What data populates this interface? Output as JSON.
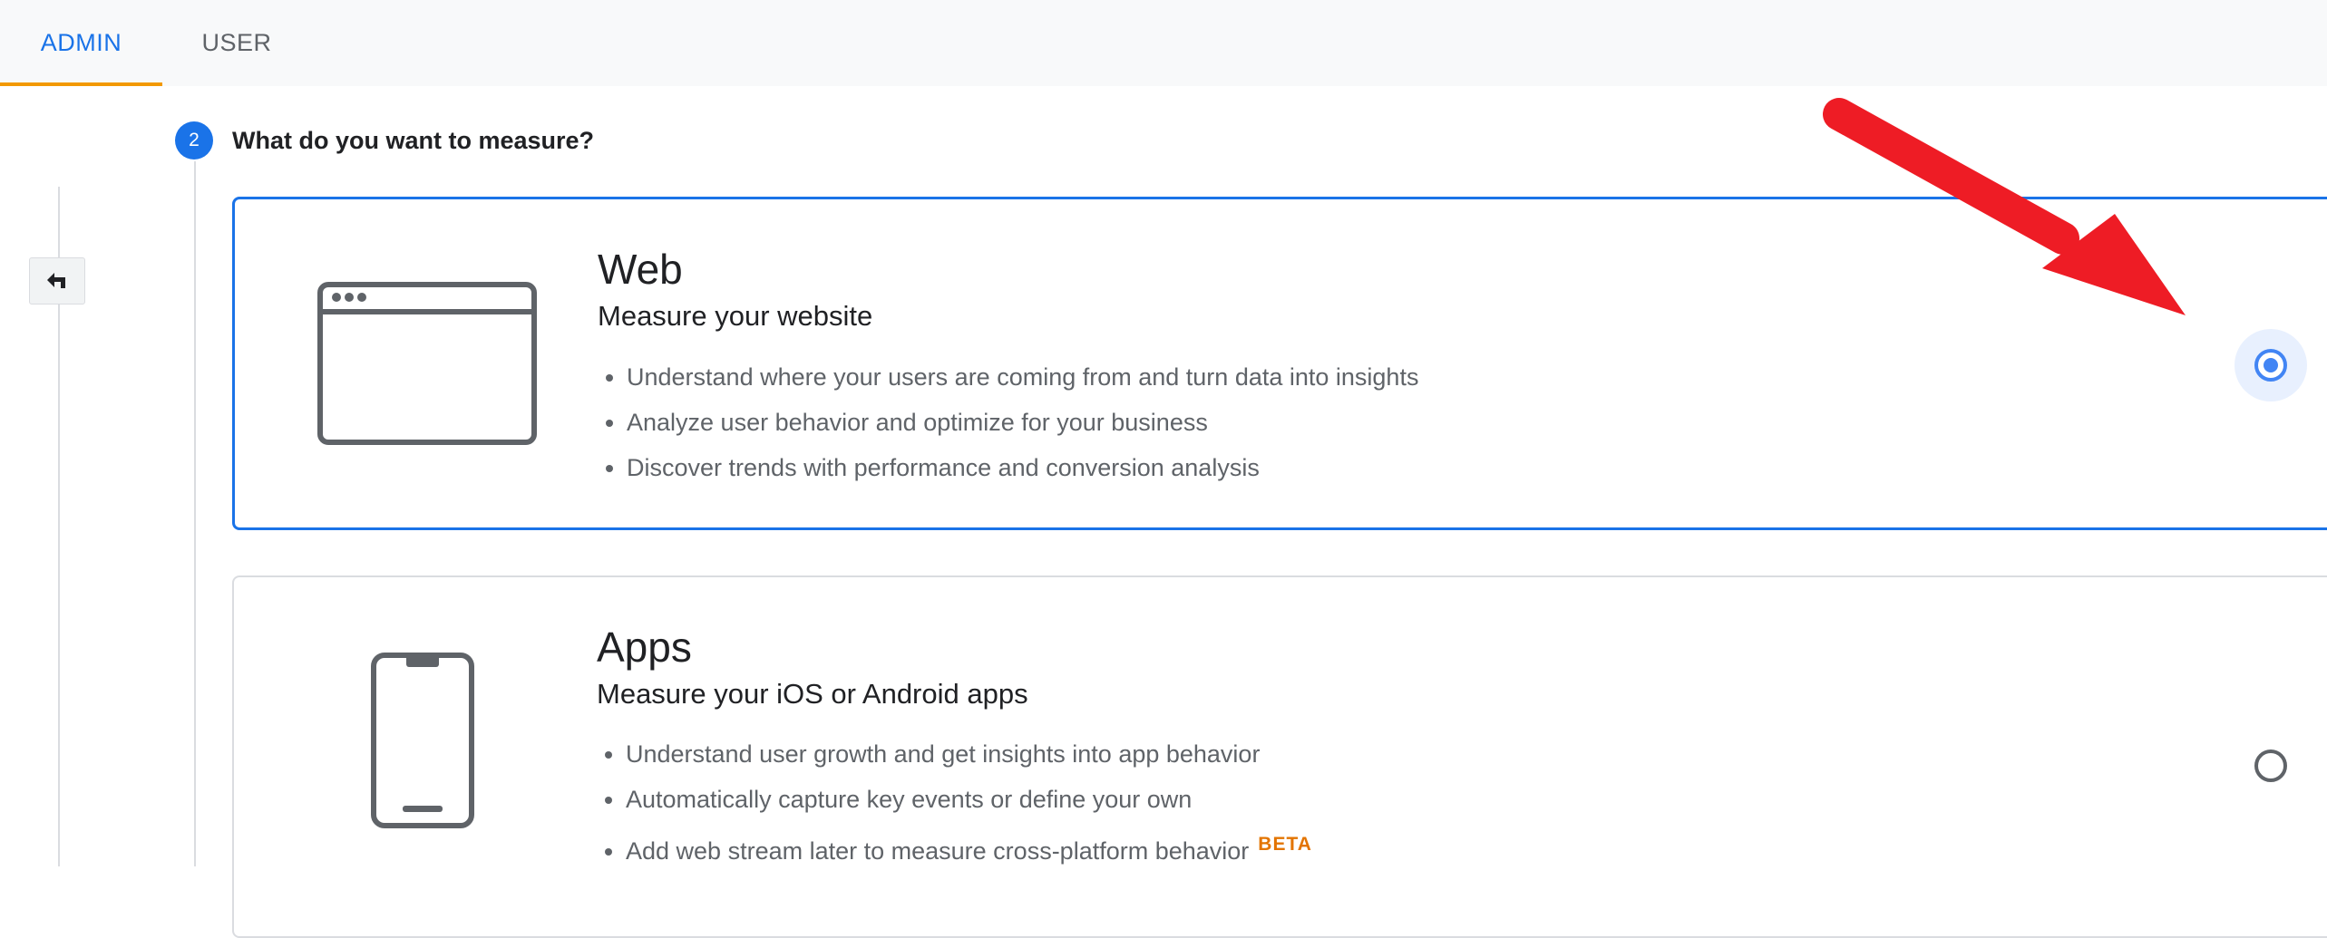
{
  "tabs": [
    {
      "label": "ADMIN",
      "active": true
    },
    {
      "label": "USER",
      "active": false
    }
  ],
  "back_button": {
    "icon": "back-arrow-icon"
  },
  "step": {
    "number": "2",
    "title": "What do you want to measure?"
  },
  "options": [
    {
      "id": "web",
      "icon": "browser-window-icon",
      "title": "Web",
      "subtitle": "Measure your website",
      "bullets": [
        "Understand where your users are coming from and turn data into insights",
        "Analyze user behavior and optimize for your business",
        "Discover trends with performance and conversion analysis"
      ],
      "selected": true
    },
    {
      "id": "apps",
      "icon": "smartphone-icon",
      "title": "Apps",
      "subtitle": "Measure your iOS or Android apps",
      "bullets": [
        "Understand user growth and get insights into app behavior",
        "Automatically capture key events or define your own",
        "Add web stream later to measure cross-platform behavior"
      ],
      "badge": "BETA",
      "selected": false
    }
  ],
  "annotation": {
    "type": "red-arrow-icon",
    "color": "#ee1c25"
  },
  "colors": {
    "accent": "#1a73e8",
    "tab_underline": "#f29900",
    "beta": "#e37400"
  }
}
